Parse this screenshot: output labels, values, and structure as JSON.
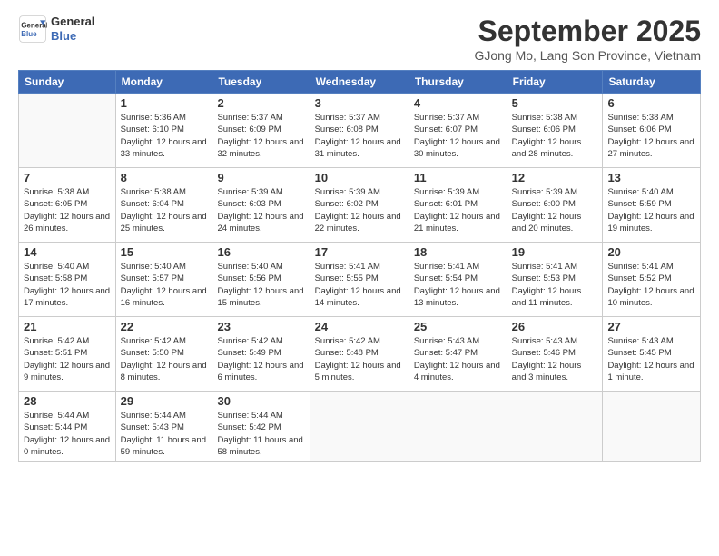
{
  "logo": {
    "line1": "General",
    "line2": "Blue"
  },
  "title": "September 2025",
  "subtitle": "GJong Mo, Lang Son Province, Vietnam",
  "days_of_week": [
    "Sunday",
    "Monday",
    "Tuesday",
    "Wednesday",
    "Thursday",
    "Friday",
    "Saturday"
  ],
  "weeks": [
    [
      {
        "day": "",
        "info": ""
      },
      {
        "day": "1",
        "info": "Sunrise: 5:36 AM\nSunset: 6:10 PM\nDaylight: 12 hours\nand 33 minutes."
      },
      {
        "day": "2",
        "info": "Sunrise: 5:37 AM\nSunset: 6:09 PM\nDaylight: 12 hours\nand 32 minutes."
      },
      {
        "day": "3",
        "info": "Sunrise: 5:37 AM\nSunset: 6:08 PM\nDaylight: 12 hours\nand 31 minutes."
      },
      {
        "day": "4",
        "info": "Sunrise: 5:37 AM\nSunset: 6:07 PM\nDaylight: 12 hours\nand 30 minutes."
      },
      {
        "day": "5",
        "info": "Sunrise: 5:38 AM\nSunset: 6:06 PM\nDaylight: 12 hours\nand 28 minutes."
      },
      {
        "day": "6",
        "info": "Sunrise: 5:38 AM\nSunset: 6:06 PM\nDaylight: 12 hours\nand 27 minutes."
      }
    ],
    [
      {
        "day": "7",
        "info": "Sunrise: 5:38 AM\nSunset: 6:05 PM\nDaylight: 12 hours\nand 26 minutes."
      },
      {
        "day": "8",
        "info": "Sunrise: 5:38 AM\nSunset: 6:04 PM\nDaylight: 12 hours\nand 25 minutes."
      },
      {
        "day": "9",
        "info": "Sunrise: 5:39 AM\nSunset: 6:03 PM\nDaylight: 12 hours\nand 24 minutes."
      },
      {
        "day": "10",
        "info": "Sunrise: 5:39 AM\nSunset: 6:02 PM\nDaylight: 12 hours\nand 22 minutes."
      },
      {
        "day": "11",
        "info": "Sunrise: 5:39 AM\nSunset: 6:01 PM\nDaylight: 12 hours\nand 21 minutes."
      },
      {
        "day": "12",
        "info": "Sunrise: 5:39 AM\nSunset: 6:00 PM\nDaylight: 12 hours\nand 20 minutes."
      },
      {
        "day": "13",
        "info": "Sunrise: 5:40 AM\nSunset: 5:59 PM\nDaylight: 12 hours\nand 19 minutes."
      }
    ],
    [
      {
        "day": "14",
        "info": "Sunrise: 5:40 AM\nSunset: 5:58 PM\nDaylight: 12 hours\nand 17 minutes."
      },
      {
        "day": "15",
        "info": "Sunrise: 5:40 AM\nSunset: 5:57 PM\nDaylight: 12 hours\nand 16 minutes."
      },
      {
        "day": "16",
        "info": "Sunrise: 5:40 AM\nSunset: 5:56 PM\nDaylight: 12 hours\nand 15 minutes."
      },
      {
        "day": "17",
        "info": "Sunrise: 5:41 AM\nSunset: 5:55 PM\nDaylight: 12 hours\nand 14 minutes."
      },
      {
        "day": "18",
        "info": "Sunrise: 5:41 AM\nSunset: 5:54 PM\nDaylight: 12 hours\nand 13 minutes."
      },
      {
        "day": "19",
        "info": "Sunrise: 5:41 AM\nSunset: 5:53 PM\nDaylight: 12 hours\nand 11 minutes."
      },
      {
        "day": "20",
        "info": "Sunrise: 5:41 AM\nSunset: 5:52 PM\nDaylight: 12 hours\nand 10 minutes."
      }
    ],
    [
      {
        "day": "21",
        "info": "Sunrise: 5:42 AM\nSunset: 5:51 PM\nDaylight: 12 hours\nand 9 minutes."
      },
      {
        "day": "22",
        "info": "Sunrise: 5:42 AM\nSunset: 5:50 PM\nDaylight: 12 hours\nand 8 minutes."
      },
      {
        "day": "23",
        "info": "Sunrise: 5:42 AM\nSunset: 5:49 PM\nDaylight: 12 hours\nand 6 minutes."
      },
      {
        "day": "24",
        "info": "Sunrise: 5:42 AM\nSunset: 5:48 PM\nDaylight: 12 hours\nand 5 minutes."
      },
      {
        "day": "25",
        "info": "Sunrise: 5:43 AM\nSunset: 5:47 PM\nDaylight: 12 hours\nand 4 minutes."
      },
      {
        "day": "26",
        "info": "Sunrise: 5:43 AM\nSunset: 5:46 PM\nDaylight: 12 hours\nand 3 minutes."
      },
      {
        "day": "27",
        "info": "Sunrise: 5:43 AM\nSunset: 5:45 PM\nDaylight: 12 hours\nand 1 minute."
      }
    ],
    [
      {
        "day": "28",
        "info": "Sunrise: 5:44 AM\nSunset: 5:44 PM\nDaylight: 12 hours\nand 0 minutes."
      },
      {
        "day": "29",
        "info": "Sunrise: 5:44 AM\nSunset: 5:43 PM\nDaylight: 11 hours\nand 59 minutes."
      },
      {
        "day": "30",
        "info": "Sunrise: 5:44 AM\nSunset: 5:42 PM\nDaylight: 11 hours\nand 58 minutes."
      },
      {
        "day": "",
        "info": ""
      },
      {
        "day": "",
        "info": ""
      },
      {
        "day": "",
        "info": ""
      },
      {
        "day": "",
        "info": ""
      }
    ]
  ]
}
